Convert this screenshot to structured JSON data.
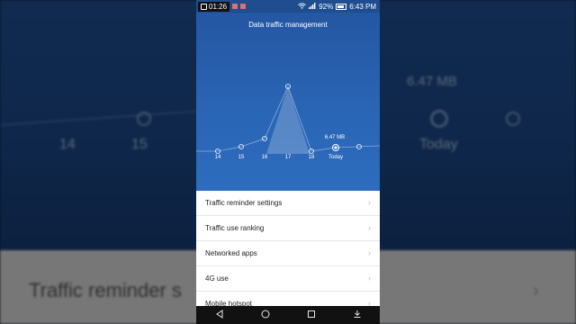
{
  "background": {
    "labels": [
      "14",
      "15"
    ],
    "right_value": "6.47 MB",
    "right_label": "Today",
    "bottom_text": "Traffic reminder s"
  },
  "statusbar": {
    "time": "01:26",
    "battery": "92%",
    "clock": "6:43 PM"
  },
  "screen": {
    "title": "Data traffic management"
  },
  "chart_data": {
    "type": "area",
    "categories": [
      "",
      "14",
      "15",
      "16",
      "17",
      "18",
      "Today",
      ""
    ],
    "peak_label": "6.47 MB",
    "highlight": "Today"
  },
  "list": [
    {
      "label": "Traffic reminder settings"
    },
    {
      "label": "Traffic use ranking"
    },
    {
      "label": "Networked apps"
    },
    {
      "label": "4G use"
    },
    {
      "label": "Mobile hotspot"
    }
  ],
  "icons": {
    "back": "back-triangle-icon",
    "home": "home-circle-icon",
    "recents": "recents-square-icon",
    "notifications": "notification-down-icon"
  }
}
